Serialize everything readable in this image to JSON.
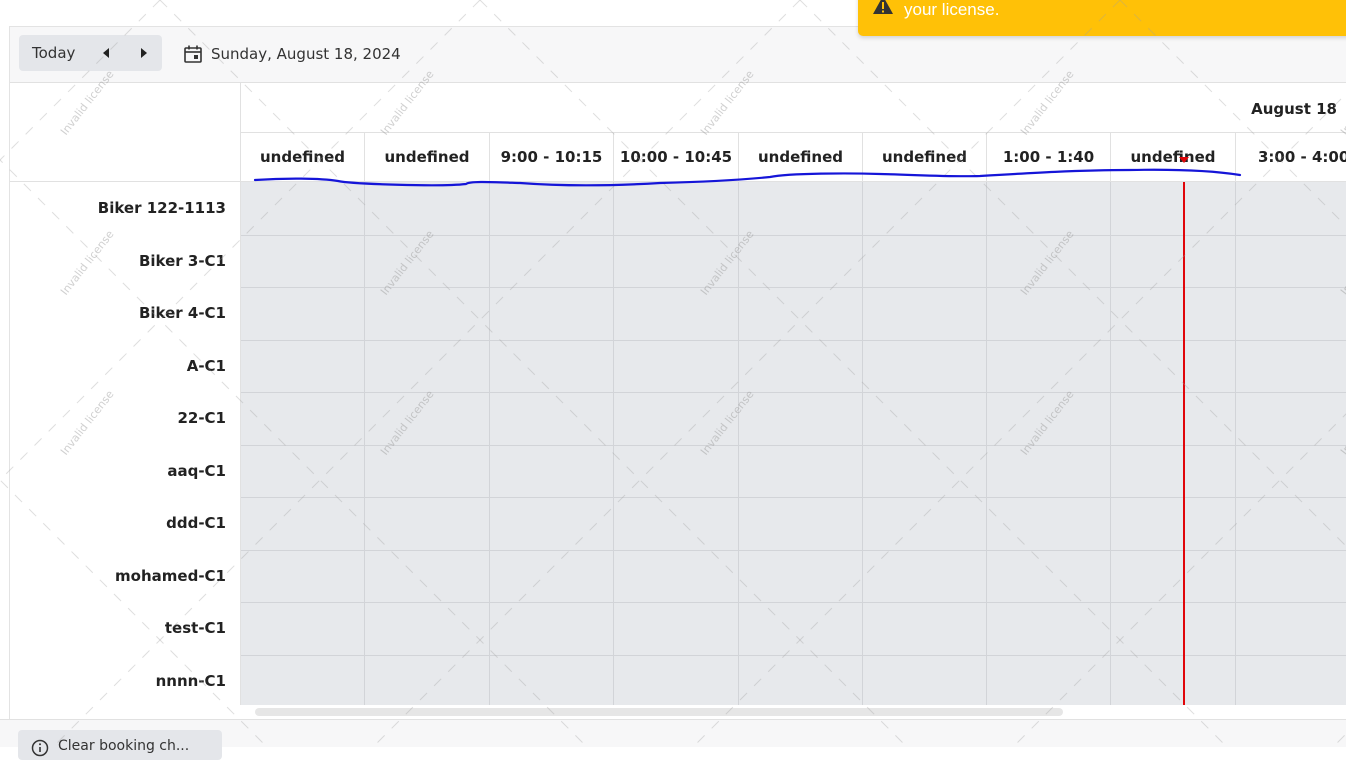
{
  "toolbar": {
    "today_label": "Today",
    "date_text": "Sunday, August 18, 2024"
  },
  "header": {
    "date_label": "August 18"
  },
  "time_slots": [
    {
      "label": "undefined"
    },
    {
      "label": "undefined"
    },
    {
      "label": "9:00 - 10:15"
    },
    {
      "label": "10:00 - 10:45"
    },
    {
      "label": "undefined"
    },
    {
      "label": "undefined"
    },
    {
      "label": "1:00 - 1:40"
    },
    {
      "label": "undefined"
    },
    {
      "label": "3:00 - 4:00"
    }
  ],
  "resources": [
    {
      "name": "Biker 122-1113"
    },
    {
      "name": "Biker 3-C1"
    },
    {
      "name": "Biker 4-C1"
    },
    {
      "name": "A-C1"
    },
    {
      "name": "22-C1"
    },
    {
      "name": "aaq-C1"
    },
    {
      "name": "ddd-C1"
    },
    {
      "name": "mohamed-C1"
    },
    {
      "name": "test-C1"
    },
    {
      "name": "nnnn-C1"
    }
  ],
  "footer": {
    "button_label": "Clear booking ch..."
  },
  "license_banner": {
    "text": "your license."
  },
  "watermark": {
    "text": "Invalid license"
  },
  "colors": {
    "grid_background": "#e7e9ec",
    "now_indicator": "#e0060a",
    "banner": "#ffc107",
    "annotation_stroke": "#1515d8"
  }
}
